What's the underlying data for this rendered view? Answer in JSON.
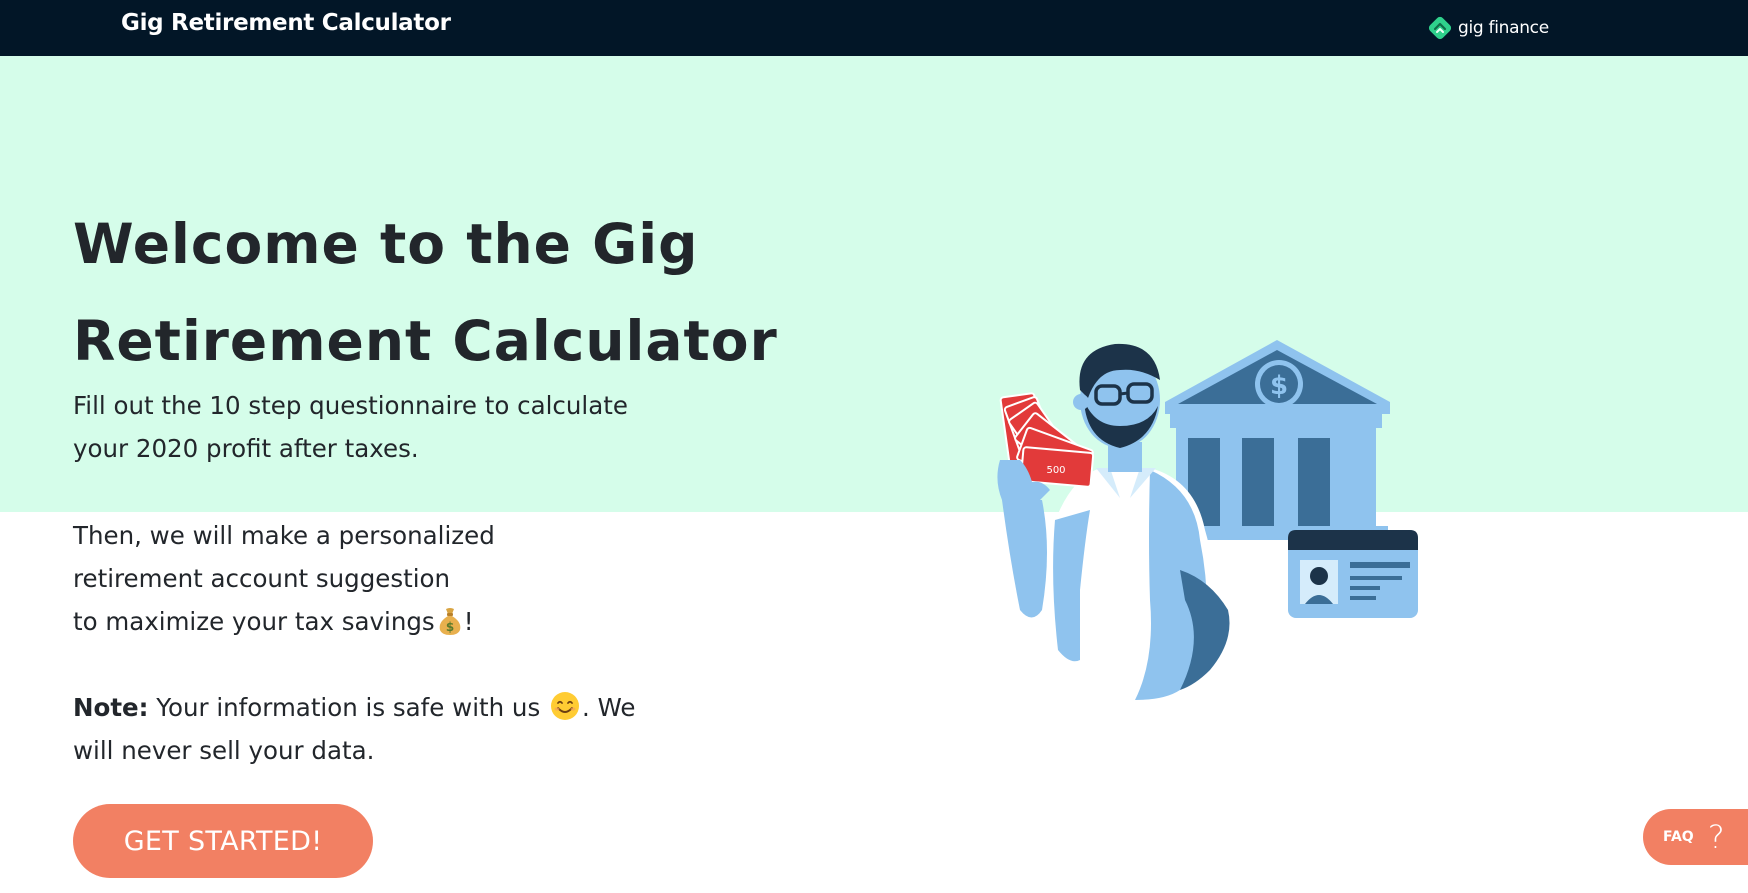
{
  "header": {
    "app_title": "Gig Retirement Calculator",
    "brand_name": "gig finance",
    "brand_logo_icon": "gig-finance-logo-icon",
    "background_color": "#021627"
  },
  "hero": {
    "band_color": "#d5fdea",
    "title_line_1": "Welcome to the Gig",
    "title_line_2": "Retirement Calculator",
    "intro_line_1": "Fill out the 10 step questionnaire to calculate",
    "intro_line_2": "your 2020 profit after taxes.",
    "suggestion_line_1": "Then, we will make a personalized",
    "suggestion_line_2": "retirement account suggestion",
    "suggestion_line_3": "to maximize your tax savings",
    "suggestion_emoji": "money-bag-icon",
    "suggestion_end": "!",
    "note_label": "Note:",
    "note_text_1": " Your information is safe with us ",
    "note_emoji": "smiling-face-icon",
    "note_text_2": ". We",
    "note_line_2": "will never sell your data.",
    "cta_label": "GET STARTED!",
    "cta_color": "#f28063",
    "illustration_icon": "man-with-cash-bank-id-card-illustration"
  },
  "faq": {
    "label": "FAQ",
    "icon": "question-mark-icon",
    "icon_glyph": "?"
  }
}
